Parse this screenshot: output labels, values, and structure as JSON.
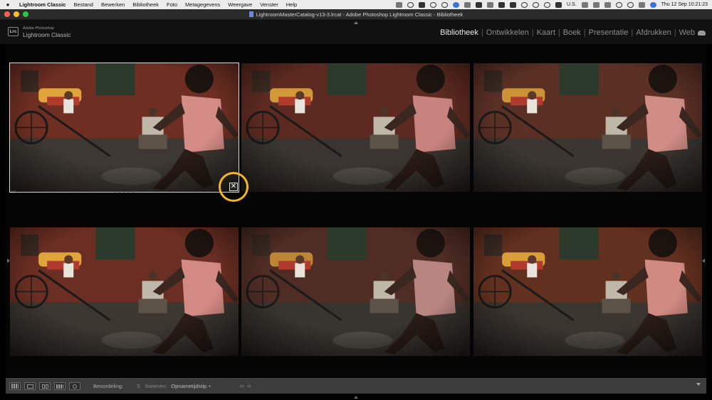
{
  "menubar": {
    "apple_icon": "apple-icon",
    "app_name": "Lightroom Classic",
    "items": [
      "Bestand",
      "Bewerken",
      "Bibliotheek",
      "Foto",
      "Metagegevens",
      "Weergave",
      "Venster",
      "Help"
    ],
    "input_source": "U.S.",
    "clock": "Thu 12 Sep  10:21:23"
  },
  "window": {
    "title": "LightroomMasterCatalog-v13-3.lrcat - Adobe Photoshop Lightroom Classic - Bibliotheek"
  },
  "identity": {
    "logo": "Lrc",
    "brand_small": "Adobe Photoshop",
    "brand_large": "Lightroom Classic"
  },
  "modules": {
    "active": "Bibliotheek",
    "items": [
      "Bibliotheek",
      "Ontwikkelen",
      "Kaart",
      "Boek",
      "Presentatie",
      "Afdrukken",
      "Web"
    ]
  },
  "grid": {
    "selected_meta": "3:3",
    "selected_dots": "• • • • •",
    "delete_glyph": "✕",
    "highlight_color": "#f3b521"
  },
  "toolbar": {
    "rating_label": "Beoordeling:",
    "sort_label": "Sorteren:",
    "sort_value": "Opnametijdstip ÷",
    "arrows": "⇦⇨"
  }
}
